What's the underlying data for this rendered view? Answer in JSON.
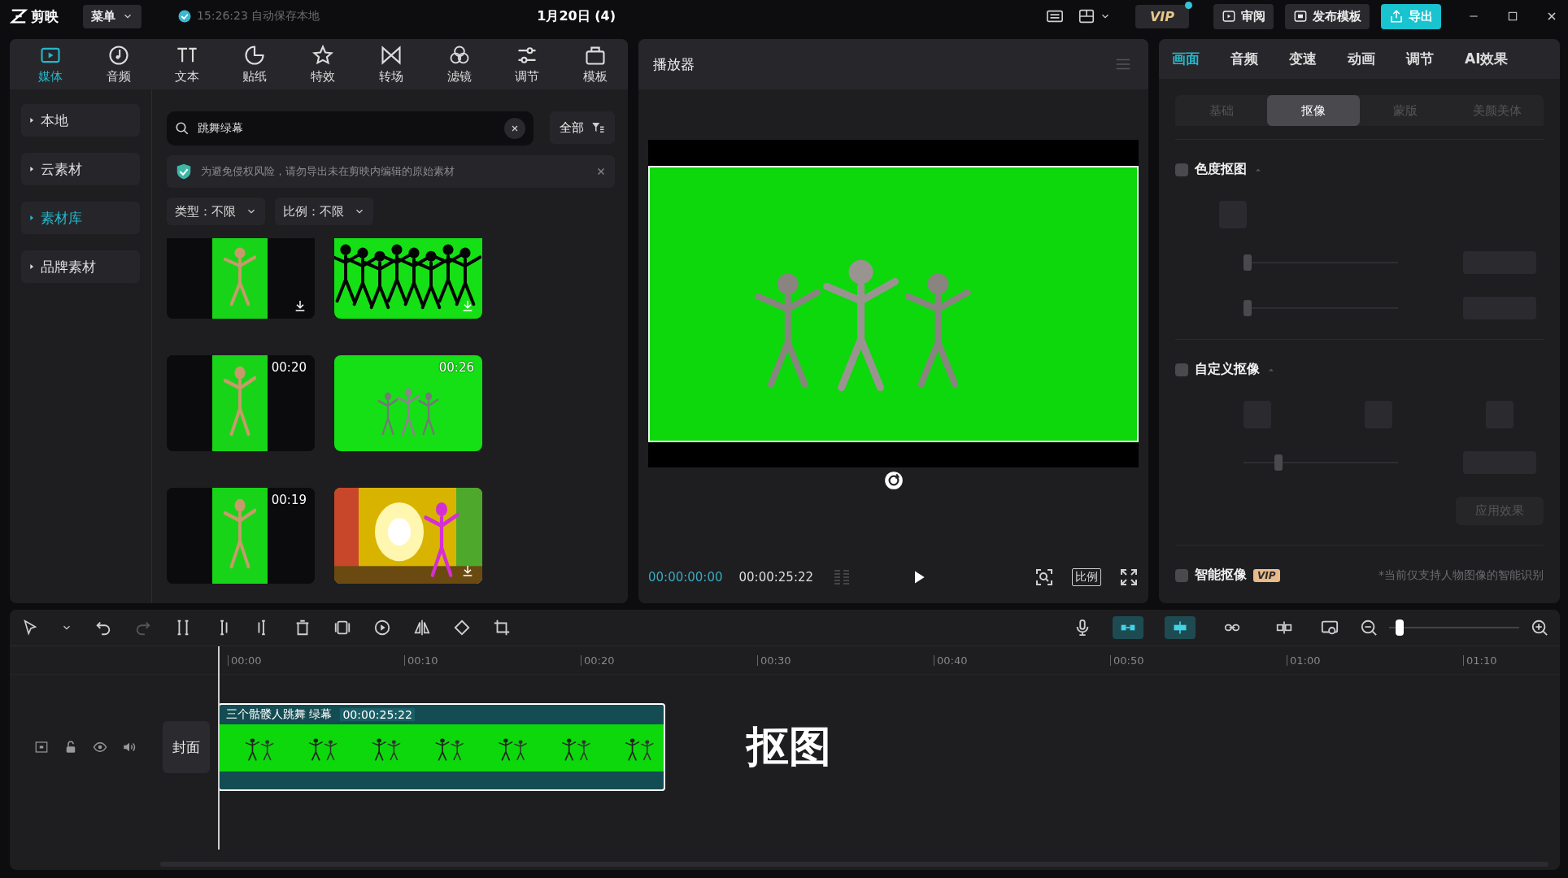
{
  "topbar": {
    "logo": "剪映",
    "menu": "菜单",
    "autosave": "15:26:23 自动保存本地",
    "title": "1月20日 (4)",
    "vip": "VIP",
    "buttons": [
      {
        "label": "审阅",
        "kind": "plain"
      },
      {
        "label": "发布模板",
        "kind": "plain"
      },
      {
        "label": "导出",
        "kind": "primary"
      }
    ]
  },
  "media_tabs": [
    {
      "label": "媒体",
      "selected": true
    },
    {
      "label": "音频",
      "selected": false
    },
    {
      "label": "文本",
      "selected": false
    },
    {
      "label": "贴纸",
      "selected": false
    },
    {
      "label": "特效",
      "selected": false
    },
    {
      "label": "转场",
      "selected": false
    },
    {
      "label": "滤镜",
      "selected": false
    },
    {
      "label": "调节",
      "selected": false
    },
    {
      "label": "模板",
      "selected": false
    }
  ],
  "sidebar": {
    "items": [
      {
        "label": "本地",
        "selected": false
      },
      {
        "label": "云素材",
        "selected": false
      },
      {
        "label": "素材库",
        "selected": true
      },
      {
        "label": "品牌素材",
        "selected": false
      }
    ]
  },
  "search": {
    "value": "跳舞绿幕"
  },
  "filter": {
    "label": "全部"
  },
  "notice": {
    "text": "为避免侵权风险，请勿导出未在剪映内编辑的原始素材"
  },
  "dropdowns": [
    {
      "label": "类型：不限"
    },
    {
      "label": "比例：不限"
    }
  ],
  "thumbnails": [
    {
      "kind": "picture",
      "downloadable": true
    },
    {
      "kind": "picture",
      "downloadable": true
    },
    {
      "kind": "picture",
      "duration": "00:20",
      "downloadable": false
    },
    {
      "kind": "picture",
      "duration": "00:26",
      "downloadable": false
    },
    {
      "kind": "picture",
      "duration": "00:19",
      "downloadable": false
    },
    {
      "kind": "picture",
      "downloadable": true
    }
  ],
  "player": {
    "title": "播放器",
    "current": "00:00:00:00",
    "total": "00:00:25:22",
    "ratio": "比例"
  },
  "inspector": {
    "tabs": [
      {
        "label": "画面",
        "selected": true
      },
      {
        "label": "音频",
        "selected": false
      },
      {
        "label": "变速",
        "selected": false
      },
      {
        "label": "动画",
        "selected": false
      },
      {
        "label": "调节",
        "selected": false
      },
      {
        "label": "AI效果",
        "selected": false
      }
    ],
    "subtabs": [
      {
        "label": "基础",
        "selected": false
      },
      {
        "label": "抠像",
        "selected": true
      },
      {
        "label": "蒙版",
        "selected": false
      },
      {
        "label": "美颜美体",
        "selected": false
      }
    ],
    "sections": [
      {
        "label": "色度抠图",
        "checked": false,
        "sliders": [
          {
            "level": 0
          },
          {
            "level": 0
          }
        ]
      },
      {
        "label": "自定义抠像",
        "checked": false,
        "sliders": [
          {
            "level": 0.2
          }
        ],
        "apply": "应用效果"
      },
      {
        "label": "智能抠像",
        "checked": false,
        "vip": "VIP",
        "note": "*当前仅支持人物图像的智能识别"
      }
    ]
  },
  "toolbar": {
    "toggles": [
      {
        "on": true
      },
      {
        "on": true
      },
      {
        "on": false
      },
      {
        "on": false
      }
    ],
    "zoom": {
      "level": 0.05
    }
  },
  "timeline": {
    "ticks": [
      "00:00",
      "00:10",
      "00:20",
      "00:30",
      "00:40",
      "00:50",
      "01:00",
      "01:10"
    ],
    "cover": "封面",
    "clip": {
      "name": "三个骷髅人跳舞 绿幕",
      "duration": "00:00:25:22",
      "selected": true
    },
    "annotation": "抠图"
  }
}
